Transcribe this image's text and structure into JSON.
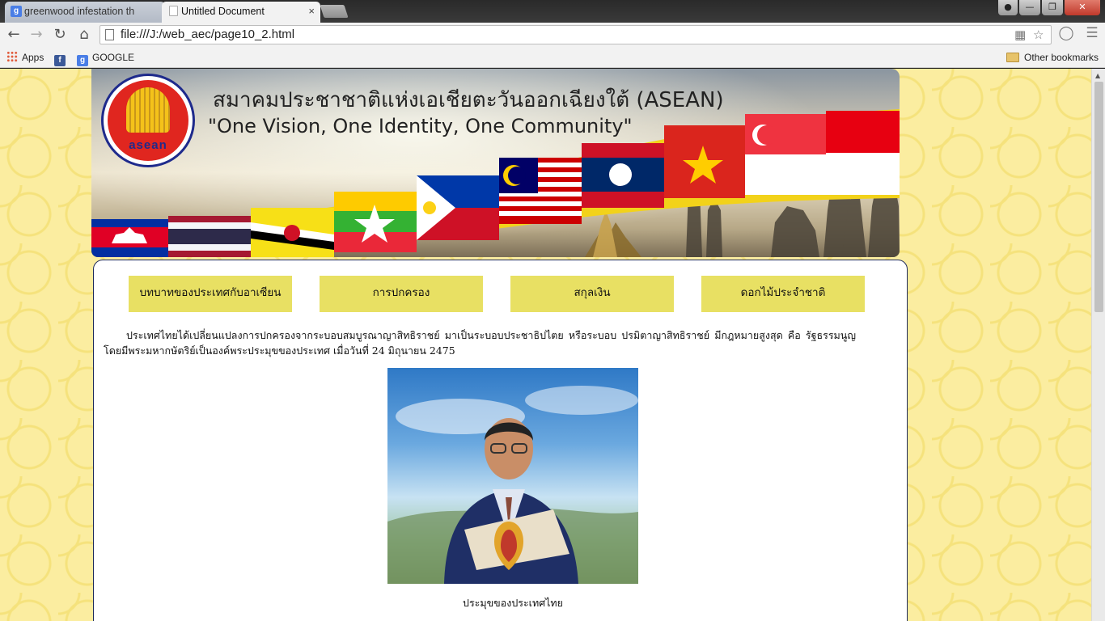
{
  "browser": {
    "tabs": [
      {
        "title": "greenwood infestation th",
        "favicon": "g-search-icon",
        "active": false
      },
      {
        "title": "Untitled Document",
        "favicon": "page-icon",
        "active": true
      }
    ],
    "tab_close_glyph": "×",
    "url": "file:///J:/web_aec/page10_2.html",
    "bookmarks": [
      {
        "label": "Apps",
        "icon": "apps-grid-icon"
      },
      {
        "label": "",
        "icon": "facebook-icon"
      },
      {
        "label": "GOOGLE",
        "icon": "google-icon"
      }
    ],
    "other_bookmarks": "Other bookmarks",
    "icon_glyphs": {
      "facebook": "f",
      "google": "g"
    }
  },
  "banner": {
    "logo_text": "asean",
    "title_th": "สมาคมประชาชาติแห่งเอเชียตะวันออกเฉียงใต้ (ASEAN)",
    "title_en": "\"One Vision, One Identity, One Community\""
  },
  "menu": {
    "items": [
      {
        "label": "บทบาทของประเทศกับอาเซียน"
      },
      {
        "label": "การปกครอง"
      },
      {
        "label": "สกุลเงิน"
      },
      {
        "label": "ดอกไม้ประจำชาติ"
      }
    ],
    "button_color": "#e8e063"
  },
  "content": {
    "intro": "ประเทศไทยได้เปลี่ยนแปลงการปกครองจากระบอบสมบูรณาญาสิทธิราชย์ มาเป็นระบอบประชาธิปไตย หรือระบอบ ปรมิตาญาสิทธิราชย์ มีกฎหมายสูงสุด คือ รัฐธรรมนูญ โดยมีพระมหากษัตริย์เป็นองค์พระประมุขของประเทศ เมื่อวันที่ 24 มิถุนายน 2475",
    "caption": "ประมุขของประเทศไทย"
  },
  "colors": {
    "page_bg": "#fbeda0",
    "panel_border": "#1e2a5c",
    "flag_band_gold": "#f2d21a"
  }
}
